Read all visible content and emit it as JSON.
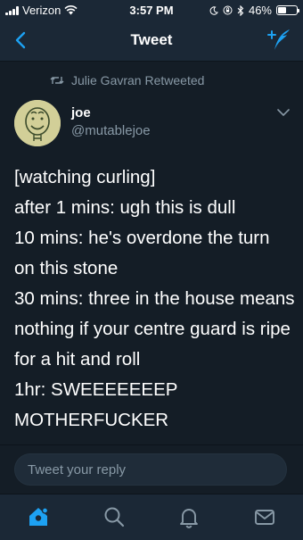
{
  "status_bar": {
    "carrier": "Verizon",
    "time": "3:57 PM",
    "battery": "46%",
    "battery_level": 0.46
  },
  "nav": {
    "title": "Tweet",
    "back_icon": "chevron-left-icon",
    "compose_icon": "compose-tweet-icon"
  },
  "tweet": {
    "retweeted_by": "Julie Gavran Retweeted",
    "author_name": "joe",
    "author_handle": "@mutablejoe",
    "text": "[watching curling]\nafter 1 mins: ugh this is dull\n10 mins: he's overdone the turn on this stone\n30 mins: three in the house means nothing if your centre guard is ripe for a hit and roll\n1hr: SWEEEEEEEP MOTHERFUCKER"
  },
  "reply": {
    "placeholder": "Tweet your reply"
  },
  "tab_bar": {
    "items": [
      "home-icon",
      "search-icon",
      "notifications-icon",
      "messages-icon"
    ],
    "active": "home-icon"
  },
  "colors": {
    "accent": "#1da1f2",
    "background": "#141d26",
    "bar": "#1b2836",
    "secondary_text": "#8899a6"
  }
}
